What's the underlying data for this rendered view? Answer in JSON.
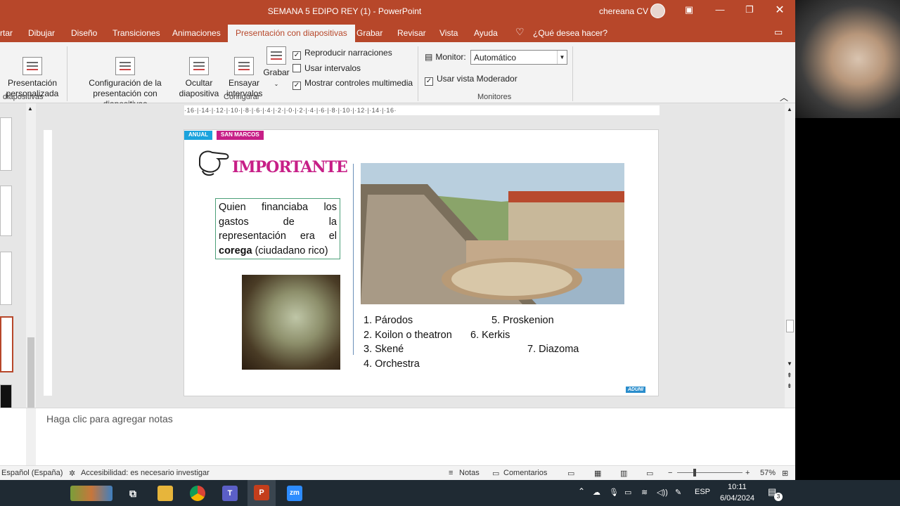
{
  "window": {
    "title": "SEMANA 5 EDIPO REY (1)  -  PowerPoint",
    "user": "chereana CV",
    "minimize_icon": "minimize-icon",
    "maximize_icon": "maximize-icon",
    "close_icon": "close-icon"
  },
  "tabs": [
    "rtar",
    "Dibujar",
    "Diseño",
    "Transiciones",
    "Animaciones",
    "Presentación con diapositivas",
    "Grabar",
    "Revisar",
    "Vista",
    "Ayuda"
  ],
  "active_tab": "Presentación con diapositivas",
  "tell_me": "¿Qué desea hacer?",
  "ribbon": {
    "custom_show": "Presentación\npersonalizada",
    "group_left": "diapositivas",
    "setup_show": "Configuración de la\npresentación con diapositivas",
    "hide_slide": "Ocultar\ndiapositiva",
    "rehearse": "Ensayar\nintervalos",
    "record": "Grabar",
    "chk_narrations": "Reproducir narraciones",
    "chk_timings": "Usar intervalos",
    "chk_media": "Mostrar controles multimedia",
    "group_configure": "Configurar",
    "monitor_label": "Monitor:",
    "monitor_value": "Automático",
    "presenter_view": "Usar vista Moderador",
    "group_monitors": "Monitores",
    "checks": {
      "narrations": true,
      "timings": false,
      "media": true,
      "presenter": true
    }
  },
  "ruler": "·16·|·14·|·12·|·10·|·8·|·6·|·4·|·2·|·0·|·2·|·4·|·6·|·8·|·10·|·12·|·14·|·16·",
  "slide": {
    "badge1": "ANUAL",
    "badge2": "SAN MARCOS",
    "heading": "IMPORTANTE",
    "note_pre": "Quien financiaba los gastos de la representación era el ",
    "note_bold": "corega",
    "note_post": " (ciudadano rico)",
    "parts": [
      "1. Párodos",
      "2. Koilon o theatron",
      "3. Skené",
      "4. Orchestra",
      "5. Proskenion",
      "6. Kerkis",
      "7. Diazoma"
    ],
    "logo": "ADUNI"
  },
  "notes_placeholder": "Haga clic para agregar notas",
  "status": {
    "language": "Español (España)",
    "accessibility": "Accesibilidad: es necesario investigar",
    "notes": "Notas",
    "comments": "Comentarios",
    "zoom": "57%"
  },
  "taskbar": {
    "lang": "ESP",
    "time": "10:11",
    "date": "6/04/2024",
    "notif_count": "3",
    "zoom_app": "zm"
  },
  "colors": {
    "accent": "#b7472a",
    "heading": "#c71f87",
    "note_border": "#4b9f78"
  }
}
